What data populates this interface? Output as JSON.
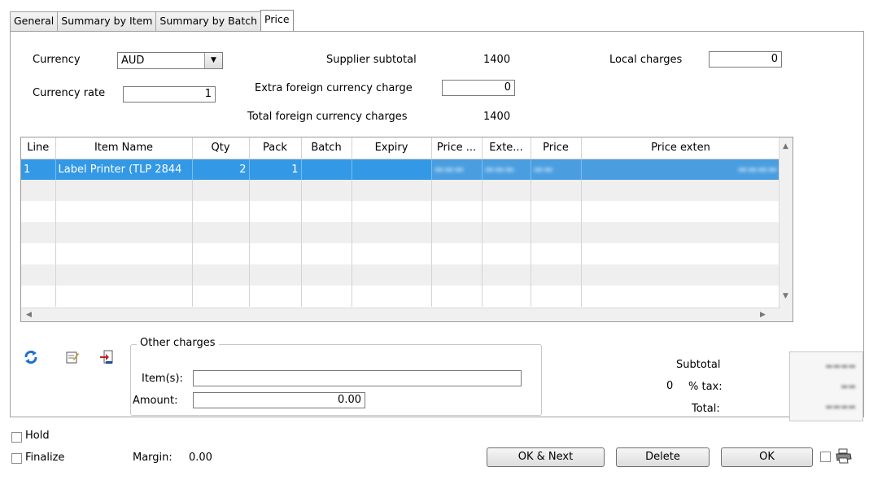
{
  "tabs": [
    "General",
    "Summary by Item",
    "Summary by Batch",
    "Price"
  ],
  "currency": {
    "label": "Currency",
    "value": "AUD"
  },
  "currency_rate": {
    "label": "Currency rate",
    "value": "1"
  },
  "supplier_subtotal": {
    "label": "Supplier subtotal",
    "value": "1400"
  },
  "extra_charge": {
    "label": "Extra foreign currency charge",
    "value": "0"
  },
  "total_foreign": {
    "label": "Total foreign currency charges",
    "value": "1400"
  },
  "local_charges": {
    "label": "Local charges",
    "value": "0"
  },
  "grid": {
    "columns": [
      "Line",
      "Item Name",
      "Qty",
      "Pack",
      "Batch",
      "Expiry",
      "Price ...",
      "Exte...",
      "Price",
      "Price exten"
    ],
    "rows": [
      {
        "line": "1",
        "item": "Label Printer (TLP 2844",
        "qty": "2",
        "pack": "1"
      }
    ]
  },
  "other_charges": {
    "title": "Other charges",
    "items_label": "Item(s):",
    "items_value": "",
    "amount_label": "Amount:",
    "amount_value": "0.00"
  },
  "totals": {
    "subtotal_label": "Subtotal",
    "tax_value": "0",
    "tax_label": "% tax:",
    "total_label": "Total:"
  },
  "footer": {
    "hold_label": "Hold",
    "finalize_label": "Finalize",
    "margin_label": "Margin:",
    "margin_value": "0.00",
    "ok_next": "OK & Next",
    "delete": "Delete",
    "ok": "OK"
  },
  "icons": [
    "refresh-icon",
    "edit-note-icon",
    "export-icon",
    "printer-icon"
  ]
}
